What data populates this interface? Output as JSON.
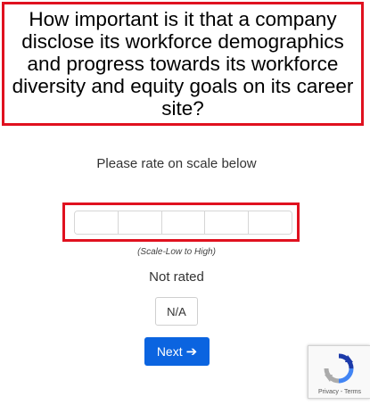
{
  "question": {
    "text": "How important is it that a company disclose its workforce demographics and progress towards its workforce diversity and equity goals on its career site?"
  },
  "rating": {
    "prompt": "Please rate on scale below",
    "scale_note": "(Scale-Low to High)",
    "cell_count": 5,
    "status": "Not rated",
    "na_label": "N/A"
  },
  "navigation": {
    "next_label": "Next",
    "next_icon": "arrow-right-icon"
  },
  "recaptcha": {
    "privacy_label": "Privacy",
    "separator": " - ",
    "terms_label": "Terms"
  },
  "colors": {
    "highlight_border": "#e0111f",
    "primary_button": "#0b64e0"
  }
}
